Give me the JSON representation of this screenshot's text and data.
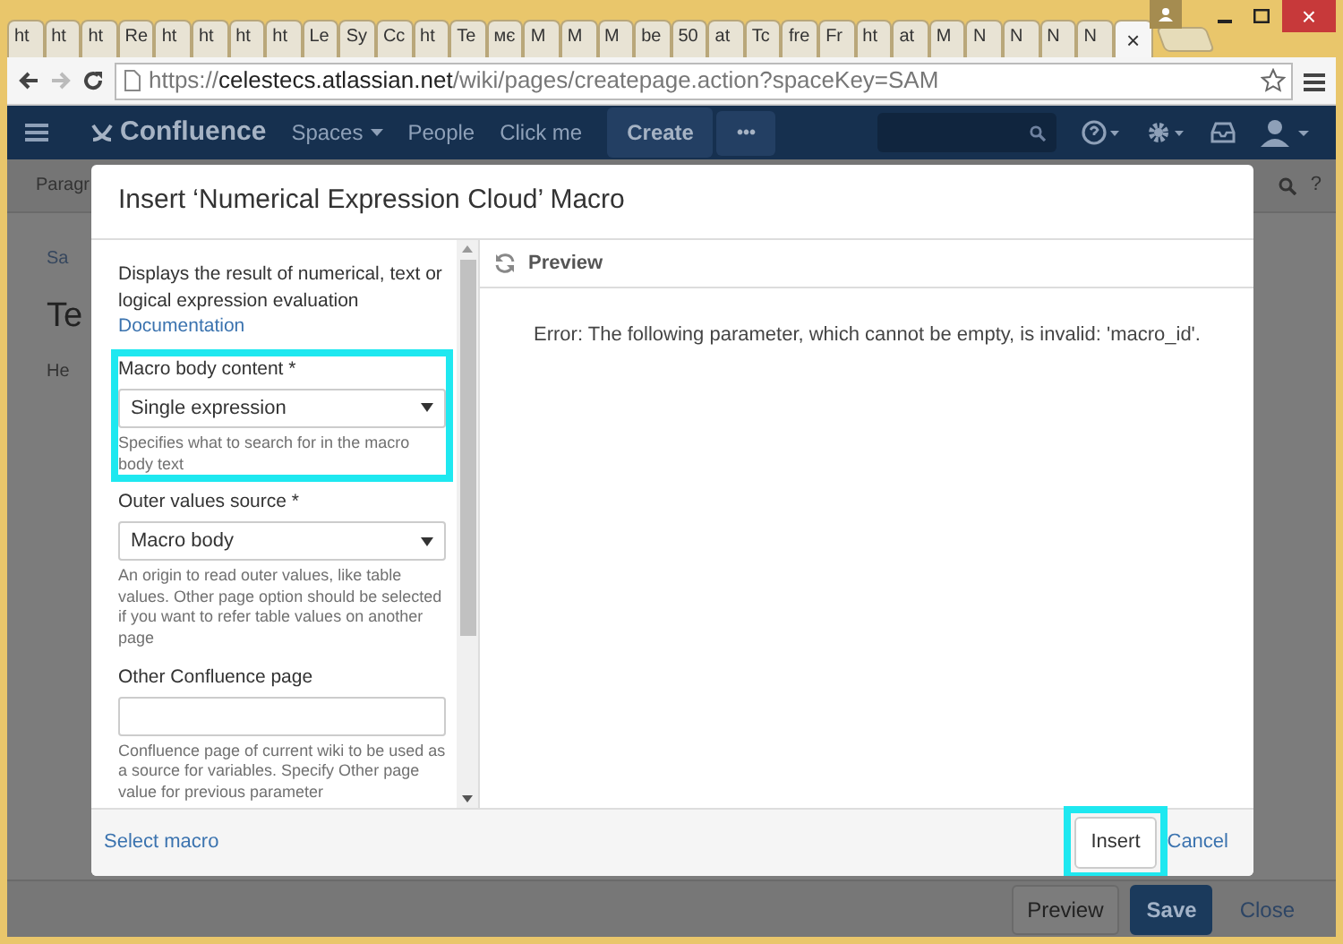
{
  "window": {
    "close_glyph": "×"
  },
  "tabs": [
    {
      "label": "ht",
      "selected": false
    },
    {
      "label": "ht",
      "selected": false
    },
    {
      "label": "ht",
      "selected": false
    },
    {
      "label": "Re",
      "selected": false
    },
    {
      "label": "ht",
      "selected": false
    },
    {
      "label": "ht",
      "selected": false
    },
    {
      "label": "ht",
      "selected": false
    },
    {
      "label": "ht",
      "selected": false
    },
    {
      "label": "Le",
      "selected": false
    },
    {
      "label": "Sy",
      "selected": false
    },
    {
      "label": "Cc",
      "selected": false
    },
    {
      "label": "ht",
      "selected": false
    },
    {
      "label": "Te",
      "selected": false
    },
    {
      "label": "мє",
      "selected": false
    },
    {
      "label": "M",
      "selected": false
    },
    {
      "label": "M",
      "selected": false
    },
    {
      "label": "M",
      "selected": false
    },
    {
      "label": "be",
      "selected": false
    },
    {
      "label": "50",
      "selected": false
    },
    {
      "label": "at",
      "selected": false
    },
    {
      "label": "Tc",
      "selected": false
    },
    {
      "label": "fre",
      "selected": false
    },
    {
      "label": "Fr",
      "selected": false
    },
    {
      "label": "ht",
      "selected": false
    },
    {
      "label": "at",
      "selected": false
    },
    {
      "label": "M",
      "selected": false
    },
    {
      "label": "N",
      "selected": false
    },
    {
      "label": "N",
      "selected": false
    },
    {
      "label": "N",
      "selected": false
    },
    {
      "label": "N",
      "selected": false
    },
    {
      "close": "×",
      "selected": true
    }
  ],
  "address_bar": {
    "scheme": "https://",
    "host": "celestecs.atlassian.net",
    "path": "/wiki/pages/createpage.action?spaceKey=SAM"
  },
  "navbar": {
    "logo": "Confluence",
    "items": [
      {
        "label": "Spaces",
        "dropdown": true
      },
      {
        "label": "People",
        "dropdown": false
      },
      {
        "label": "Click me",
        "dropdown": false
      }
    ],
    "create": "Create",
    "more": "•••"
  },
  "page": {
    "toolbar": "Paragr",
    "help": "?",
    "breadcrumb": "Sa",
    "title": "Te",
    "body": "He"
  },
  "dialog": {
    "title": "Insert ‘Numerical Expression Cloud’ Macro",
    "description": "Displays the result of numerical, text or logical expression evaluation",
    "doc_link": "Documentation",
    "fields": [
      {
        "kind": "select",
        "label": "Macro body content *",
        "value": "Single expression",
        "help": "Specifies what to search for in the macro body text",
        "highlighted": true
      },
      {
        "kind": "select",
        "label": "Outer values source *",
        "value": "Macro body",
        "help": "An origin to read outer values, like table values. Other page option should be selected if you want to refer table values on another page",
        "highlighted": false
      },
      {
        "kind": "text",
        "label": "Other Confluence page",
        "help": "Confluence page of current wiki to be used as a source for variables. Specify Other page value for previous parameter",
        "highlighted": false
      }
    ],
    "preview_title": "Preview",
    "error": "Error: The following parameter, which cannot be empty, is invalid: 'macro_id'.",
    "select_macro": "Select macro",
    "insert": {
      "label": "Insert",
      "highlighted": true
    },
    "cancel": "Cancel"
  },
  "footer": {
    "buttons": [
      {
        "label": "Preview",
        "kind": "default"
      },
      {
        "label": "Save",
        "kind": "primary"
      },
      {
        "label": "Close",
        "kind": "link"
      }
    ]
  }
}
